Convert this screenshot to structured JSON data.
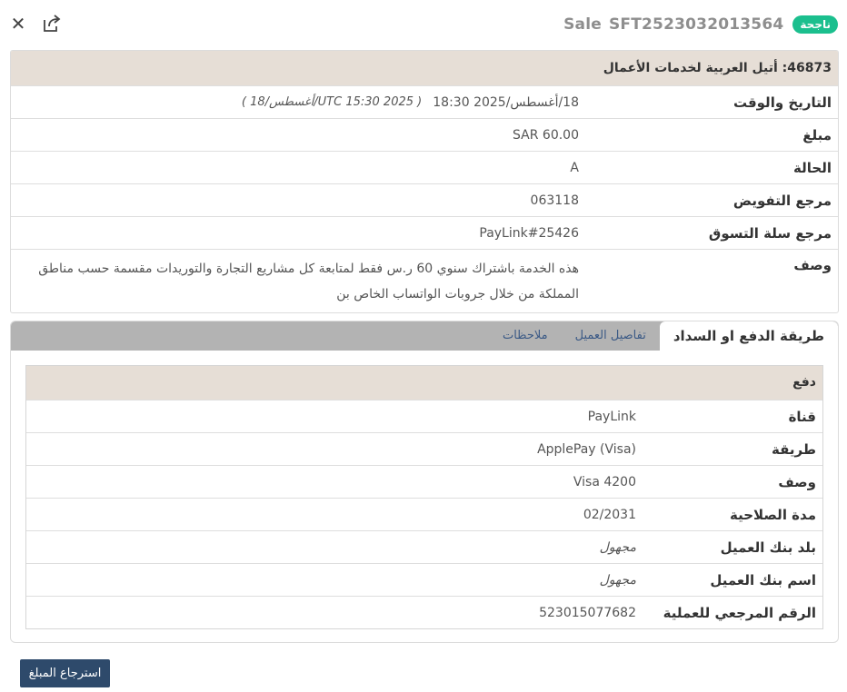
{
  "header": {
    "close_icon": "close-icon",
    "share_icon": "share-icon",
    "transaction_type": "Sale",
    "transaction_id": "SFT2523032013564",
    "status_badge": "ناجحة",
    "badge_color": "#1bbf8e"
  },
  "details": {
    "merchant_title": "46873: أتيل العربية لخدمات الأعمال",
    "rows": [
      {
        "label": "التاريخ والوقت",
        "value": "18/أغسطس/2025 18:30",
        "secondary": "( UTC 15:30 2025/أغسطس/18 )"
      },
      {
        "label": "مبلغ",
        "value": "SAR 60.00"
      },
      {
        "label": "الحالة",
        "value": "A"
      },
      {
        "label": "مرجع التفويض",
        "value": "063118"
      },
      {
        "label": "مرجع سلة التسوق",
        "value": "PayLink#25426"
      },
      {
        "label": "وصف",
        "value": "هذه الخدمة باشتراك سنوي 60 ر.س فقط لمتابعة كل مشاريع التجارة والتوريدات مقسمة حسب مناطق المملكة من خلال جروبات الواتساب الخاص بن"
      }
    ]
  },
  "tabs": [
    {
      "label": "طريقة الدفع او السداد",
      "active": true
    },
    {
      "label": "تفاصيل العميل",
      "active": false
    },
    {
      "label": "ملاحظات",
      "active": false
    }
  ],
  "payment": {
    "section_title": "دفع",
    "rows": [
      {
        "label": "قناة",
        "value": "PayLink"
      },
      {
        "label": "طريقة",
        "value": "ApplePay (Visa)"
      },
      {
        "label": "وصف",
        "value": "Visa 4200"
      },
      {
        "label": "مدة الصلاحية",
        "value": "02/2031"
      },
      {
        "label": "بلد بنك العميل",
        "value": "مجهول"
      },
      {
        "label": "اسم بنك العميل",
        "value": "مجهول"
      },
      {
        "label": "الرقم المرجعي للعملية",
        "value": "523015077682"
      }
    ]
  },
  "actions": {
    "refund_label": "استرجاع المبلغ",
    "refund_color": "#2e4a6b"
  }
}
